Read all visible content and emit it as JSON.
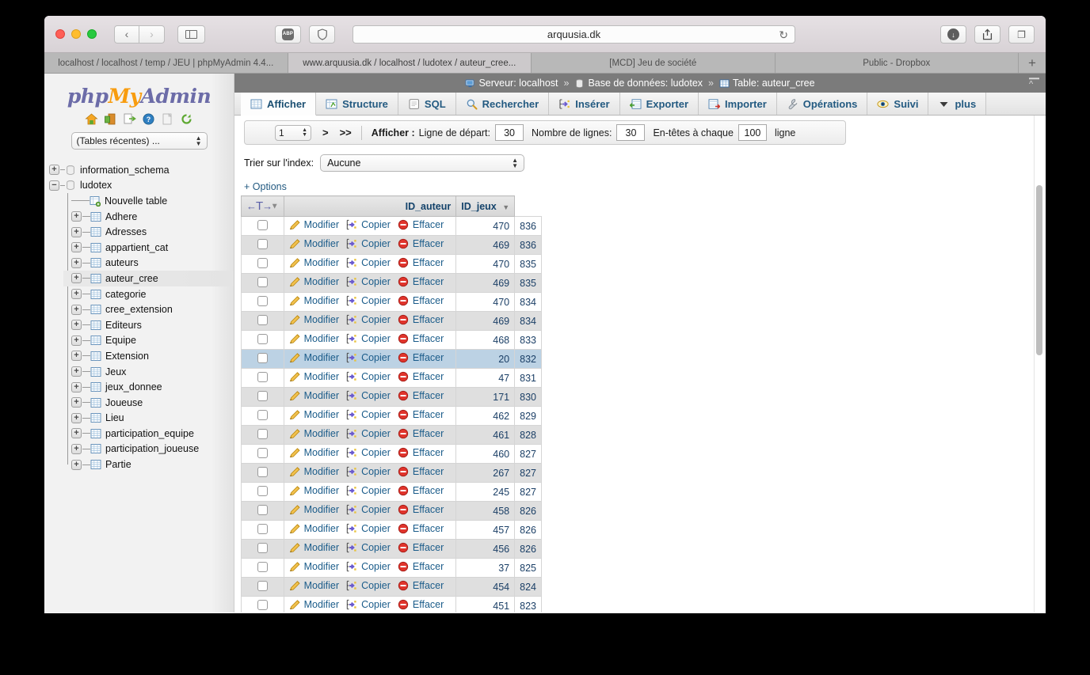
{
  "browser": {
    "url": "arquusia.dk",
    "tabs": [
      {
        "label": "localhost / localhost / temp / JEU | phpMyAdmin 4.4...",
        "active": false
      },
      {
        "label": "www.arquusia.dk / localhost / ludotex / auteur_cree...",
        "active": true
      },
      {
        "label": "[MCD] Jeu de société",
        "active": false
      },
      {
        "label": "Public - Dropbox",
        "active": false
      }
    ],
    "new_tab_label": "+",
    "back_label": "‹",
    "forward_label": "›",
    "reload_label": "↻",
    "abp_label": "ABP",
    "download_label": "↓",
    "share_label": "↑",
    "tabs_overview_label": "❐"
  },
  "nav": {
    "logo_php": "php",
    "logo_my": "My",
    "logo_admin": "Admin",
    "icons": [
      "home-icon",
      "logout-icon",
      "doc-external-icon",
      "help-icon",
      "blank-doc-icon",
      "reload-icon"
    ],
    "recent_tables_label": "(Tables récentes) ...",
    "databases": [
      {
        "label": "information_schema",
        "expanded": false,
        "type": "db"
      },
      {
        "label": "ludotex",
        "expanded": true,
        "type": "db"
      }
    ],
    "tables": [
      {
        "label": "Nouvelle table",
        "type": "new",
        "selected": false
      },
      {
        "label": "Adhere",
        "type": "table",
        "selected": false
      },
      {
        "label": "Adresses",
        "type": "table",
        "selected": false
      },
      {
        "label": "appartient_cat",
        "type": "table",
        "selected": false
      },
      {
        "label": "auteurs",
        "type": "table",
        "selected": false
      },
      {
        "label": "auteur_cree",
        "type": "table",
        "selected": true
      },
      {
        "label": "categorie",
        "type": "table",
        "selected": false
      },
      {
        "label": "cree_extension",
        "type": "table",
        "selected": false
      },
      {
        "label": "Editeurs",
        "type": "table",
        "selected": false
      },
      {
        "label": "Equipe",
        "type": "table",
        "selected": false
      },
      {
        "label": "Extension",
        "type": "table",
        "selected": false
      },
      {
        "label": "Jeux",
        "type": "table",
        "selected": false
      },
      {
        "label": "jeux_donnee",
        "type": "table",
        "selected": false
      },
      {
        "label": "Joueuse",
        "type": "table",
        "selected": false
      },
      {
        "label": "Lieu",
        "type": "table",
        "selected": false
      },
      {
        "label": "participation_equipe",
        "type": "table",
        "selected": false
      },
      {
        "label": "participation_joueuse",
        "type": "table",
        "selected": false
      },
      {
        "label": "Partie",
        "type": "table",
        "selected": false
      }
    ]
  },
  "breadcrumb": {
    "server_label": "Serveur: localhost",
    "database_label": "Base de données: ludotex",
    "table_label": "Table: auteur_cree",
    "separator": "»"
  },
  "tabs": [
    {
      "label": "Afficher",
      "icon": "browse-icon",
      "active": true
    },
    {
      "label": "Structure",
      "icon": "structure-icon",
      "active": false
    },
    {
      "label": "SQL",
      "icon": "sql-icon",
      "active": false
    },
    {
      "label": "Rechercher",
      "icon": "search-icon",
      "active": false
    },
    {
      "label": "Insérer",
      "icon": "insert-icon",
      "active": false
    },
    {
      "label": "Exporter",
      "icon": "export-icon",
      "active": false
    },
    {
      "label": "Importer",
      "icon": "import-icon",
      "active": false
    },
    {
      "label": "Opérations",
      "icon": "wrench-icon",
      "active": false
    },
    {
      "label": "Suivi",
      "icon": "eye-icon",
      "active": false
    },
    {
      "label": "plus",
      "icon": "chevron-down-icon",
      "active": false
    }
  ],
  "toolbar": {
    "page_number": "1",
    "next_label": ">",
    "last_label": ">>",
    "show_label": "Afficher :",
    "start_row_label": "Ligne de départ:",
    "start_row_value": "30",
    "num_rows_label": "Nombre de lignes:",
    "num_rows_value": "30",
    "headers_every_label": "En-têtes à chaque",
    "headers_every_value": "100",
    "line_label": "ligne"
  },
  "sort": {
    "label": "Trier sur l'index:",
    "value": "Aucune"
  },
  "options_link": "+ Options",
  "table": {
    "action_labels": {
      "edit": "Modifier",
      "copy": "Copier",
      "delete": "Effacer"
    },
    "columns": [
      "ID_auteur",
      "ID_jeux"
    ],
    "rows": [
      {
        "id_auteur": "470",
        "id_jeux": "836",
        "marked": false
      },
      {
        "id_auteur": "469",
        "id_jeux": "836",
        "marked": false
      },
      {
        "id_auteur": "470",
        "id_jeux": "835",
        "marked": false
      },
      {
        "id_auteur": "469",
        "id_jeux": "835",
        "marked": false
      },
      {
        "id_auteur": "470",
        "id_jeux": "834",
        "marked": false
      },
      {
        "id_auteur": "469",
        "id_jeux": "834",
        "marked": false
      },
      {
        "id_auteur": "468",
        "id_jeux": "833",
        "marked": false
      },
      {
        "id_auteur": "20",
        "id_jeux": "832",
        "marked": true
      },
      {
        "id_auteur": "47",
        "id_jeux": "831",
        "marked": false
      },
      {
        "id_auteur": "171",
        "id_jeux": "830",
        "marked": false
      },
      {
        "id_auteur": "462",
        "id_jeux": "829",
        "marked": false
      },
      {
        "id_auteur": "461",
        "id_jeux": "828",
        "marked": false
      },
      {
        "id_auteur": "460",
        "id_jeux": "827",
        "marked": false
      },
      {
        "id_auteur": "267",
        "id_jeux": "827",
        "marked": false
      },
      {
        "id_auteur": "245",
        "id_jeux": "827",
        "marked": false
      },
      {
        "id_auteur": "458",
        "id_jeux": "826",
        "marked": false
      },
      {
        "id_auteur": "457",
        "id_jeux": "826",
        "marked": false
      },
      {
        "id_auteur": "456",
        "id_jeux": "826",
        "marked": false
      },
      {
        "id_auteur": "37",
        "id_jeux": "825",
        "marked": false
      },
      {
        "id_auteur": "454",
        "id_jeux": "824",
        "marked": false
      },
      {
        "id_auteur": "451",
        "id_jeux": "823",
        "marked": false
      }
    ]
  },
  "colors": {
    "accent_link": "#1b5c8a",
    "tab_text": "#235a81",
    "breadcrumb_bg": "#7b7b7b",
    "marked_row": "#bcd2e4",
    "even_row": "#dfdfdf",
    "logo_orange": "#f89c0e",
    "logo_purple": "#6c6ca8"
  }
}
